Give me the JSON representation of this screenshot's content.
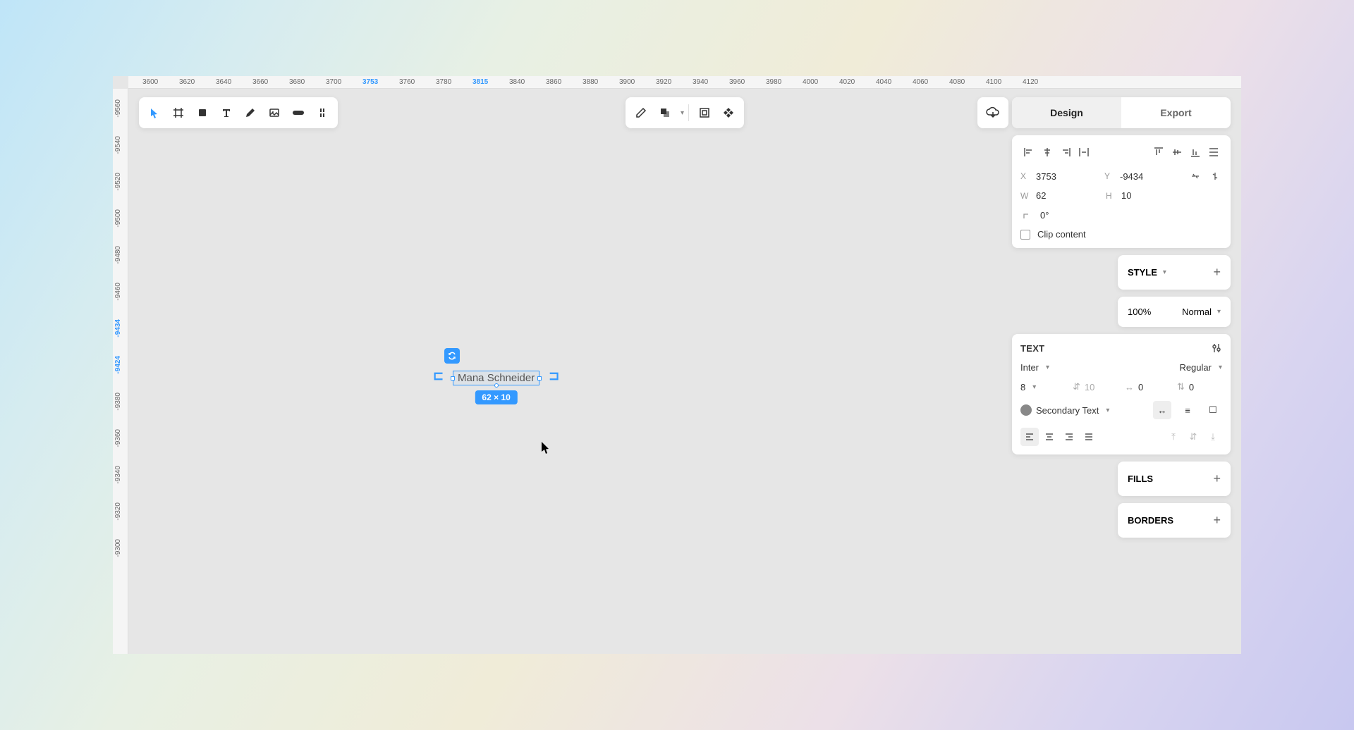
{
  "ruler_top": [
    {
      "v": "3600",
      "active": false
    },
    {
      "v": "3620",
      "active": false
    },
    {
      "v": "3640",
      "active": false
    },
    {
      "v": "3660",
      "active": false
    },
    {
      "v": "3680",
      "active": false
    },
    {
      "v": "3700",
      "active": false
    },
    {
      "v": "3753",
      "active": true
    },
    {
      "v": "3760",
      "active": false
    },
    {
      "v": "3780",
      "active": false
    },
    {
      "v": "3815",
      "active": true
    },
    {
      "v": "3840",
      "active": false
    },
    {
      "v": "3860",
      "active": false
    },
    {
      "v": "3880",
      "active": false
    },
    {
      "v": "3900",
      "active": false
    },
    {
      "v": "3920",
      "active": false
    },
    {
      "v": "3940",
      "active": false
    },
    {
      "v": "3960",
      "active": false
    },
    {
      "v": "3980",
      "active": false
    },
    {
      "v": "4000",
      "active": false
    },
    {
      "v": "4020",
      "active": false
    },
    {
      "v": "4040",
      "active": false
    },
    {
      "v": "4060",
      "active": false
    },
    {
      "v": "4080",
      "active": false
    },
    {
      "v": "4100",
      "active": false
    },
    {
      "v": "4120",
      "active": false
    }
  ],
  "ruler_left": [
    {
      "v": "-9560",
      "active": false
    },
    {
      "v": "-9540",
      "active": false
    },
    {
      "v": "-9520",
      "active": false
    },
    {
      "v": "-9500",
      "active": false
    },
    {
      "v": "-9480",
      "active": false
    },
    {
      "v": "-9460",
      "active": false
    },
    {
      "v": "-9434",
      "active": true
    },
    {
      "v": "-9424",
      "active": true
    },
    {
      "v": "-9380",
      "active": false
    },
    {
      "v": "-9360",
      "active": false
    },
    {
      "v": "-9340",
      "active": false
    },
    {
      "v": "-9320",
      "active": false
    },
    {
      "v": "-9300",
      "active": false
    }
  ],
  "tabs": {
    "design": "Design",
    "export": "Export"
  },
  "position": {
    "x_label": "X",
    "x": "3753",
    "y_label": "Y",
    "y": "-9434",
    "w_label": "W",
    "w": "62",
    "h_label": "H",
    "h": "10",
    "r": "0°"
  },
  "clip_content": "Clip content",
  "style": {
    "label": "STYLE"
  },
  "opacity": {
    "percent": "100%",
    "blend": "Normal"
  },
  "text": {
    "label": "TEXT",
    "font": "Inter",
    "weight": "Regular",
    "size": "8",
    "line_height": "10",
    "letter_spacing": "0",
    "paragraph_spacing": "0",
    "color_name": "Secondary Text"
  },
  "fills": {
    "label": "FILLS"
  },
  "borders": {
    "label": "BORDERS"
  },
  "selection": {
    "text": "Mana Schneider",
    "dimensions": "62 × 10"
  }
}
